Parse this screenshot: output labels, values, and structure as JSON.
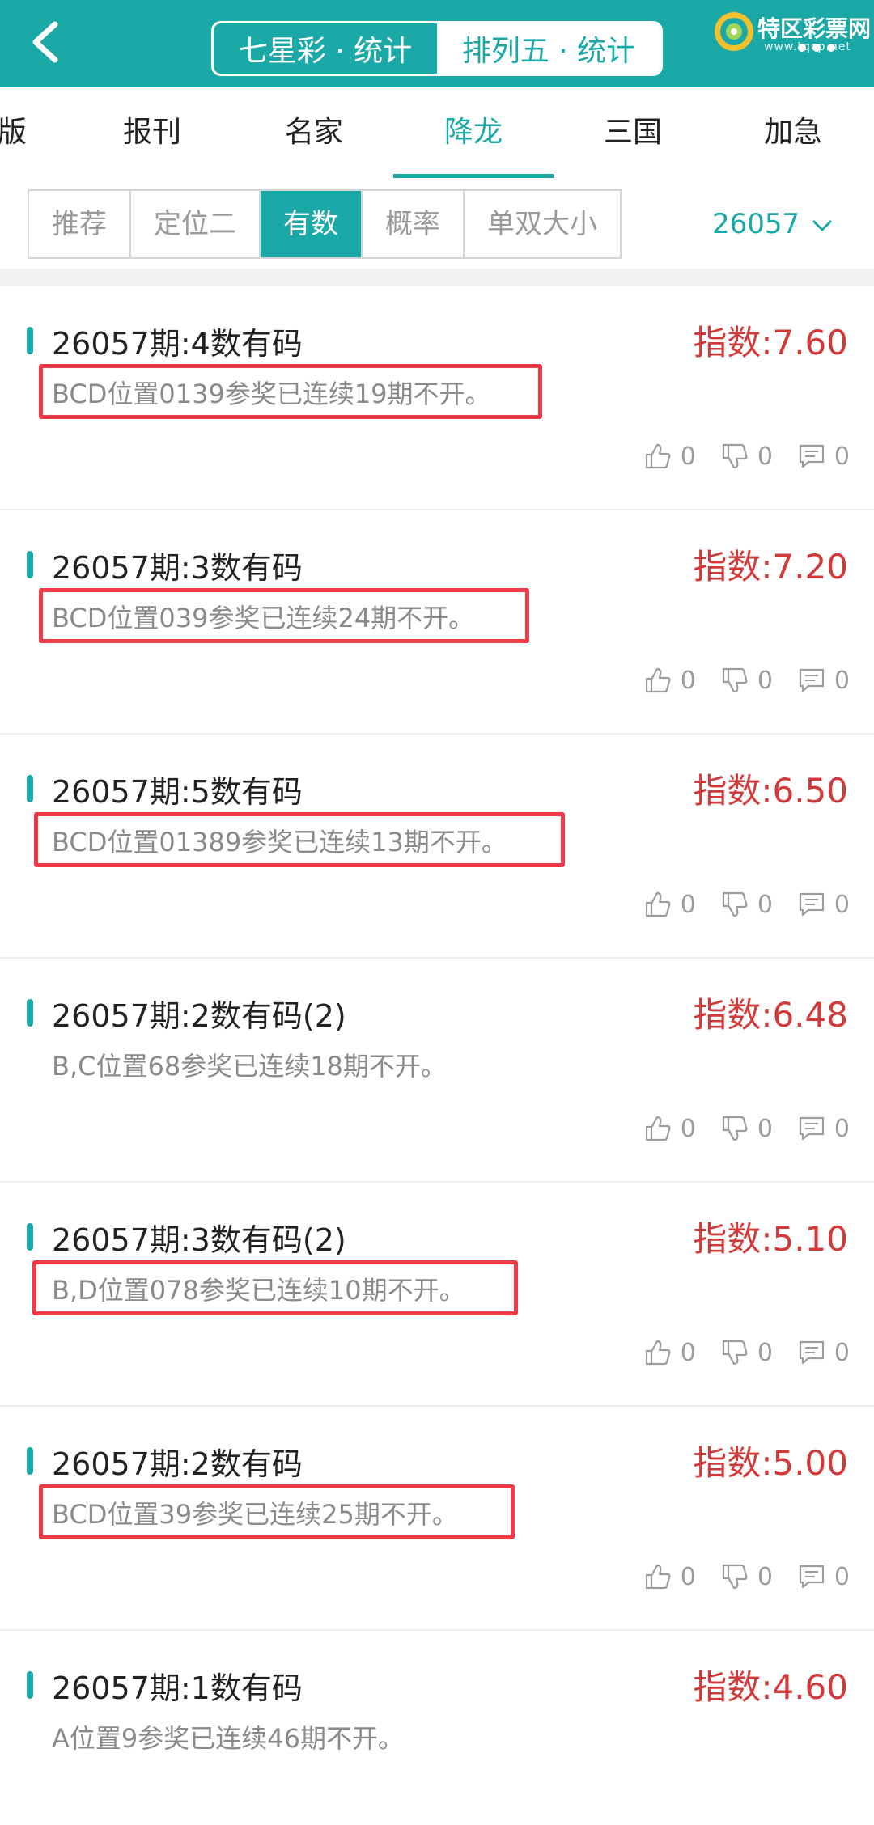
{
  "header": {
    "lottery_tabs": [
      {
        "label": "七星彩 · 统计",
        "active": false
      },
      {
        "label": "排列五 · 统计",
        "active": true
      }
    ],
    "logo_text": "特区彩票网",
    "logo_url": "www.tqcp.net"
  },
  "category_tabs": [
    {
      "label": "版"
    },
    {
      "label": "报刊"
    },
    {
      "label": "名家"
    },
    {
      "label": "降龙",
      "active": true
    },
    {
      "label": "三国"
    },
    {
      "label": "加急"
    }
  ],
  "filters": [
    {
      "label": "推荐"
    },
    {
      "label": "定位二"
    },
    {
      "label": "有数",
      "active": true
    },
    {
      "label": "概率"
    },
    {
      "label": "单双大小"
    }
  ],
  "issue_selector": {
    "value": "26057"
  },
  "items": [
    {
      "title": "26057期:4数有码",
      "index": "指数:7.60",
      "desc": "BCD位置0139参奖已连续19期不开。",
      "likes": "0",
      "dislikes": "0",
      "comments": "0",
      "highlighted": true
    },
    {
      "title": "26057期:3数有码",
      "index": "指数:7.20",
      "desc": "BCD位置039参奖已连续24期不开。",
      "likes": "0",
      "dislikes": "0",
      "comments": "0",
      "highlighted": true
    },
    {
      "title": "26057期:5数有码",
      "index": "指数:6.50",
      "desc": "BCD位置01389参奖已连续13期不开。",
      "likes": "0",
      "dislikes": "0",
      "comments": "0",
      "highlighted": true
    },
    {
      "title": "26057期:2数有码(2)",
      "index": "指数:6.48",
      "desc": "B,C位置68参奖已连续18期不开。",
      "likes": "0",
      "dislikes": "0",
      "comments": "0",
      "highlighted": false
    },
    {
      "title": "26057期:3数有码(2)",
      "index": "指数:5.10",
      "desc": "B,D位置078参奖已连续10期不开。",
      "likes": "0",
      "dislikes": "0",
      "comments": "0",
      "highlighted": true
    },
    {
      "title": "26057期:2数有码",
      "index": "指数:5.00",
      "desc": "BCD位置39参奖已连续25期不开。",
      "likes": "0",
      "dislikes": "0",
      "comments": "0",
      "highlighted": true
    },
    {
      "title": "26057期:1数有码",
      "index": "指数:4.60",
      "desc": "A位置9参奖已连续46期不开。",
      "highlighted": false
    }
  ],
  "colors": {
    "brand": "#1aa9a6",
    "index_red": "#d23a3a",
    "highlight_red": "#ee3b47"
  }
}
